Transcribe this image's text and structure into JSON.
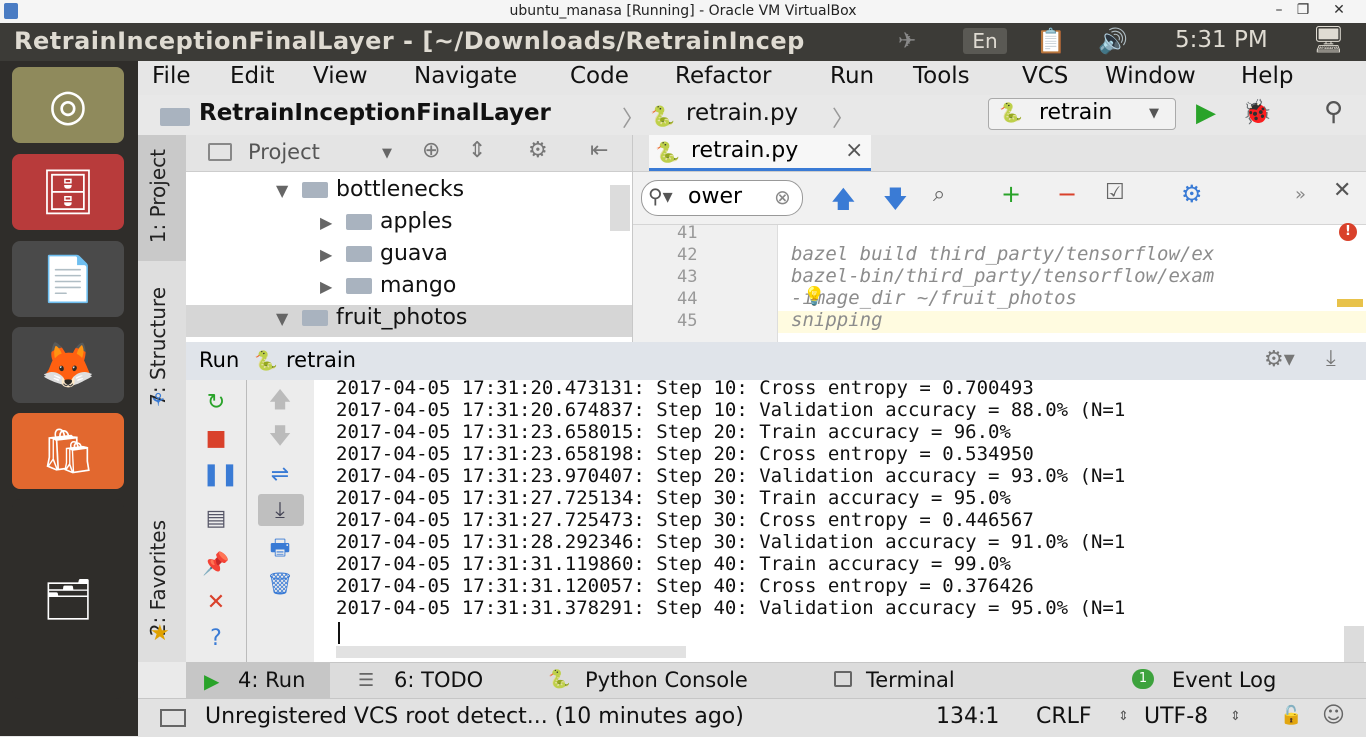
{
  "host_window": {
    "title": "ubuntu_manasa [Running] - Oracle VM VirtualBox",
    "minimize": "–",
    "maximize": "❐",
    "close": "✕"
  },
  "ubuntu_panel": {
    "window_title": "RetrainInceptionFinalLayer - [~/Downloads/RetrainIncep",
    "keyboard": "En",
    "clock": "5:31 PM"
  },
  "menu": [
    "File",
    "Edit",
    "View",
    "Navigate",
    "Code",
    "Refactor",
    "Run",
    "Tools",
    "VCS",
    "Window",
    "Help"
  ],
  "navbar": {
    "project": "RetrainInceptionFinalLayer",
    "file": "retrain.py",
    "run_config": "retrain"
  },
  "side_tabs": {
    "project": "1: Project",
    "structure": "7: Structure",
    "favorites": "2: Favorites"
  },
  "project_panel": {
    "header": "Project",
    "tree": [
      {
        "label": "bottlenecks",
        "expanded": true
      },
      {
        "label": "apples",
        "expanded": false
      },
      {
        "label": "guava",
        "expanded": false
      },
      {
        "label": "mango",
        "expanded": false
      },
      {
        "label": "fruit_photos",
        "expanded": true
      }
    ]
  },
  "editor": {
    "tab": "retrain.py",
    "tab_close": "×",
    "search_value": "ower",
    "lines": [
      {
        "num": "41",
        "text": ""
      },
      {
        "num": "42",
        "text": "bazel build third_party/tensorflow/ex"
      },
      {
        "num": "43",
        "text": "bazel-bin/third_party/tensorflow/exam"
      },
      {
        "num": "44",
        "text": "-image_dir ~/fruit_photos"
      },
      {
        "num": "45",
        "text": "snipping"
      }
    ]
  },
  "run_panel": {
    "title": "Run",
    "config": "retrain",
    "console": [
      "2017-04-05 17:31:20.473131: Step 10: Cross entropy = 0.700493",
      "2017-04-05 17:31:20.674837: Step 10: Validation accuracy = 88.0% (N=1",
      "2017-04-05 17:31:23.658015: Step 20: Train accuracy = 96.0%",
      "2017-04-05 17:31:23.658198: Step 20: Cross entropy = 0.534950",
      "2017-04-05 17:31:23.970407: Step 20: Validation accuracy = 93.0% (N=1",
      "2017-04-05 17:31:27.725134: Step 30: Train accuracy = 95.0%",
      "2017-04-05 17:31:27.725473: Step 30: Cross entropy = 0.446567",
      "2017-04-05 17:31:28.292346: Step 30: Validation accuracy = 91.0% (N=1",
      "2017-04-05 17:31:31.119860: Step 40: Train accuracy = 99.0%",
      "2017-04-05 17:31:31.120057: Step 40: Cross entropy = 0.376426",
      "2017-04-05 17:31:31.378291: Step 40: Validation accuracy = 95.0% (N=1"
    ]
  },
  "bottom_tabs": [
    "4: Run",
    "6: TODO",
    "Python Console",
    "Terminal",
    "Event Log"
  ],
  "event_log_count": "1",
  "status_bar": {
    "message": "Unregistered VCS root detect... (10 minutes ago)",
    "position": "134:1",
    "line_sep": "CRLF",
    "encoding": "UTF-8"
  },
  "colors": {
    "panel": "#3c3b37",
    "launcher": "#2f2d2a",
    "accent_blue": "#3a7bd5",
    "run_green": "#29a329",
    "stop_red": "#d9412b"
  }
}
